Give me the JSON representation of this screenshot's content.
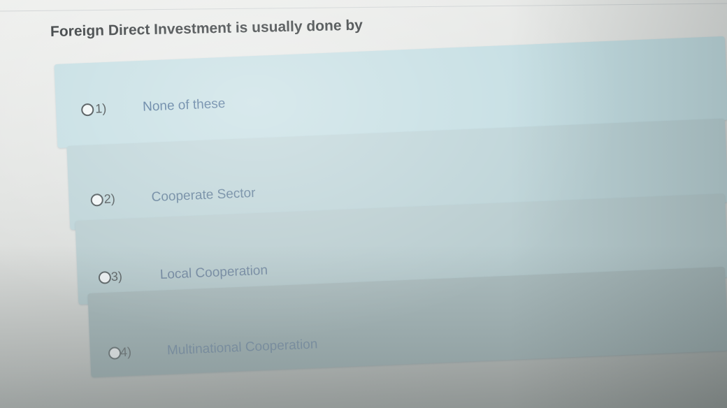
{
  "question": {
    "text": "Foreign Direct Investment is usually done by"
  },
  "options": [
    {
      "number": "1)",
      "label": "None of these"
    },
    {
      "number": "2)",
      "label": "Cooperate Sector"
    },
    {
      "number": "3)",
      "label": "Local Cooperation"
    },
    {
      "number": "4)",
      "label": "Multinational Cooperation"
    }
  ],
  "colors": {
    "option_background": "#c3dde2",
    "question_text": "#2f3436",
    "option_text": "#456b92"
  }
}
